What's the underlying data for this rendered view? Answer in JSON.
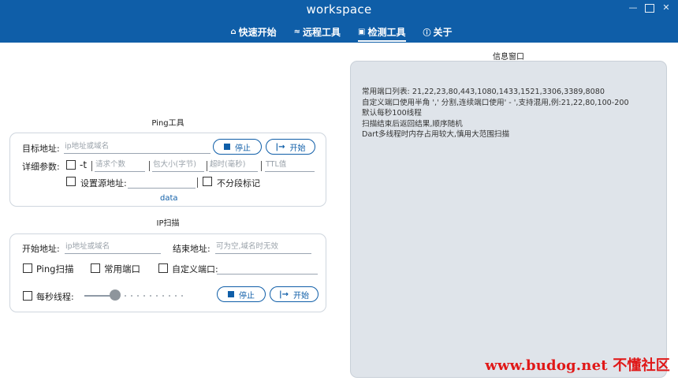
{
  "window": {
    "title": "workspace"
  },
  "nav": [
    {
      "icon": "home-icon",
      "glyph": "⌂",
      "label": "快速开始"
    },
    {
      "icon": "wifi-icon",
      "glyph": "≈",
      "label": "远程工具"
    },
    {
      "icon": "terminal-icon",
      "glyph": "▣",
      "label": "检测工具"
    },
    {
      "icon": "info-icon",
      "glyph": "ⓘ",
      "label": "关于"
    }
  ],
  "active_tab": "检测工具",
  "ping": {
    "title": "Ping工具",
    "target_label": "目标地址:",
    "target_placeholder": "ip地址或域名",
    "stop_label": "停止",
    "start_label": "开始",
    "detail_label": "详细参数:",
    "t_label": "-t",
    "count_placeholder": "请求个数",
    "size_placeholder": "包大小(字节)",
    "timeout_placeholder": "超时(毫秒)",
    "ttl_placeholder": "TTL值",
    "source_label": "设置源地址:",
    "nofrag_label": "不分段标记",
    "data_link": "data"
  },
  "ipscan": {
    "title": "IP扫描",
    "start_label": "开始地址:",
    "start_placeholder": "ip地址或域名",
    "end_label": "结束地址:",
    "end_placeholder": "可为空,域名时无效",
    "ping_scan": "Ping扫描",
    "common_ports": "常用端口",
    "custom_ports": "自定义端口:",
    "threads_label": "每秒线程:",
    "stop_label": "停止",
    "begin_label": "开始"
  },
  "info": {
    "title": "信息窗口",
    "lines": [
      "常用端口列表: 21,22,23,80,443,1080,1433,1521,3306,3389,8080",
      "自定义端口使用半角 ',' 分割,连续端口使用' - ',支持混用,例:21,22,80,100-200",
      "默认每秒100线程",
      "扫描结束后返回结果,顺序随机",
      "Dart多线程时内存占用较大,慎用大范围扫描"
    ]
  },
  "watermark": "www.budog.net 不懂社区",
  "colors": {
    "primary": "#0f5ea8",
    "panel": "#dfe4ea",
    "watermark": "#e01818"
  }
}
